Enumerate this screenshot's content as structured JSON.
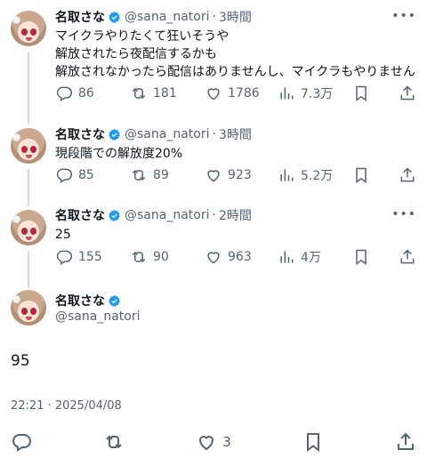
{
  "author": {
    "name": "名取さな",
    "handle": "@sana_natori"
  },
  "tweets": [
    {
      "time": "3時間",
      "text": "マイクラやりたくて狂いそうや\n解放されたら夜配信するかも\n解放されなかったら配信はありませんし、マイクラもやりません",
      "replies": "86",
      "reposts": "181",
      "likes": "1786",
      "views": "7.3万"
    },
    {
      "time": "3時間",
      "text": "現段階での解放度20%",
      "replies": "85",
      "reposts": "89",
      "likes": "923",
      "views": "5.2万"
    },
    {
      "time": "2時間",
      "text": "25",
      "replies": "155",
      "reposts": "90",
      "likes": "963",
      "views": "4万"
    }
  ],
  "focal": {
    "text": "95",
    "timestamp": "22:21 · 2025/04/08",
    "likes": "3"
  },
  "separator": "·",
  "more_glyph": "•••",
  "colors": {
    "verified": "#1d9bf0",
    "secondary": "#536471",
    "line": "#cfd9de"
  }
}
